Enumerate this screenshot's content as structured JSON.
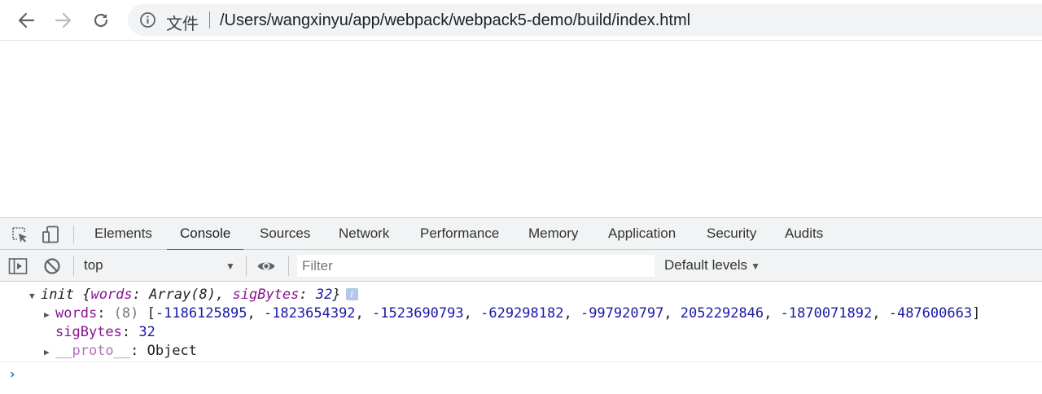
{
  "browser": {
    "site_label": "文件",
    "url": "/Users/wangxinyu/app/webpack/webpack5-demo/build/index.html"
  },
  "devtools": {
    "tabs": [
      {
        "label": "Elements"
      },
      {
        "label": "Console",
        "active": true
      },
      {
        "label": "Sources"
      },
      {
        "label": "Network"
      },
      {
        "label": "Performance"
      },
      {
        "label": "Memory"
      },
      {
        "label": "Application"
      },
      {
        "label": "Security"
      },
      {
        "label": "Audits"
      }
    ],
    "accent_color": "#1a73e8"
  },
  "console_bar": {
    "context": "top",
    "filter_placeholder": "Filter",
    "levels_label": "Default levels"
  },
  "console": {
    "entry": {
      "name": "init",
      "summary_open": "{",
      "summary_words_key": "words",
      "summary_words_value": "Array(8)",
      "summary_sig_key": "sigBytes",
      "summary_sig_value": "32",
      "summary_close": "}",
      "info_badge": "i",
      "words": {
        "key": "words",
        "count": "(8)",
        "values": [
          "-1186125895",
          "-1823654392",
          "-1523690793",
          "-629298182",
          "-997920797",
          "2052292846",
          "-1870071892",
          "-487600663"
        ]
      },
      "sigBytes": {
        "key": "sigBytes",
        "value": "32"
      },
      "proto": {
        "key": "__proto__",
        "value": "Object"
      }
    },
    "prompt": "›"
  },
  "icons": {
    "back": "arrow-left-icon",
    "forward": "arrow-right-icon",
    "reload": "reload-icon",
    "info": "info-icon",
    "inspect": "inspect-element-icon",
    "device": "device-toolbar-icon",
    "sidebar": "show-sidebar-icon",
    "clear": "clear-console-icon",
    "eye": "live-expression-icon"
  }
}
